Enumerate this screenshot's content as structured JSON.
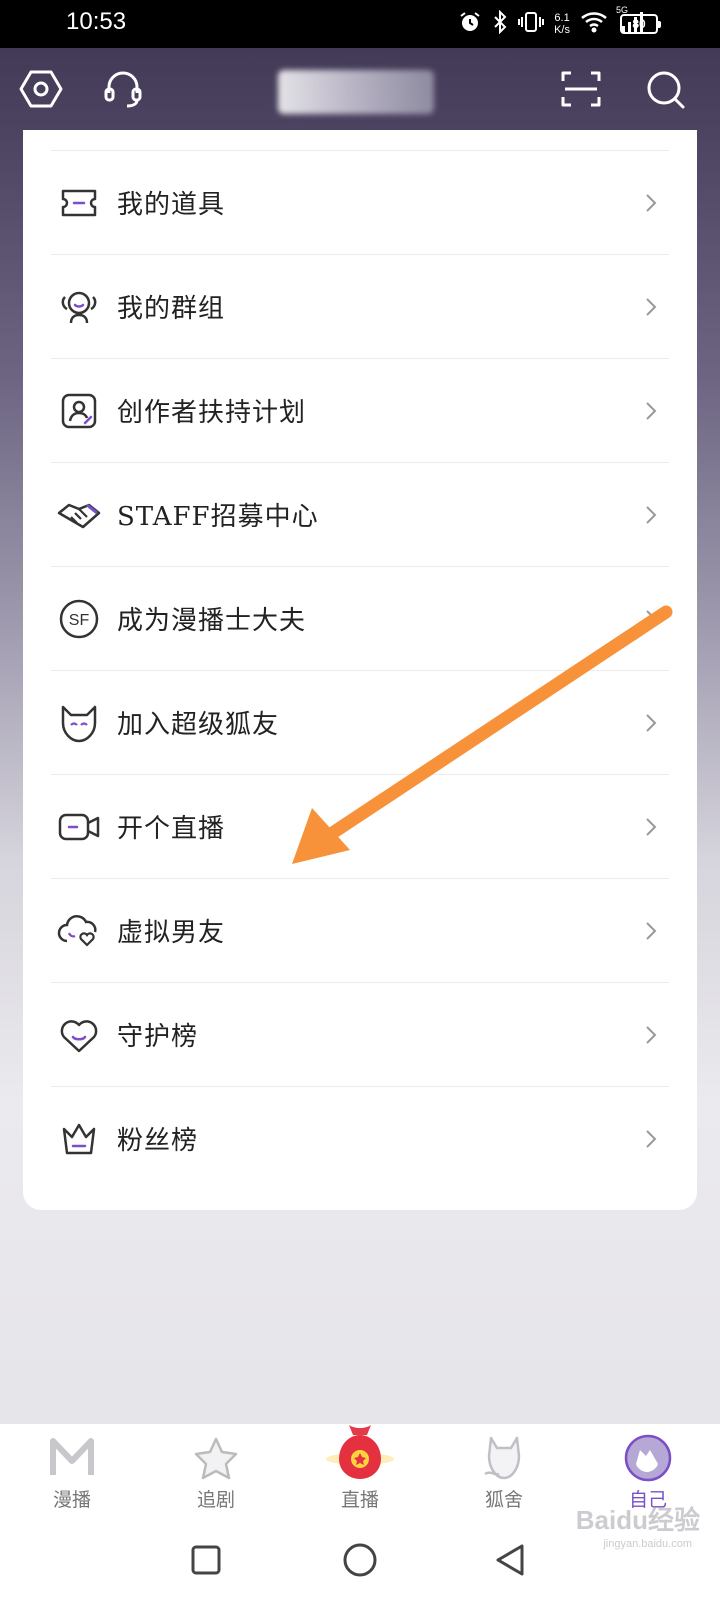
{
  "status_bar": {
    "time": "10:53",
    "net_speed_value": "6.1",
    "net_speed_unit": "K/s",
    "network": "5G",
    "battery": "80"
  },
  "header": {
    "settings_icon": "hexagon-settings-icon",
    "service_icon": "headset-icon",
    "scan_icon": "scan-icon",
    "search_icon": "search-icon"
  },
  "menu": {
    "items": [
      {
        "label": "我的道具",
        "icon": "ticket-icon"
      },
      {
        "label": "我的群组",
        "icon": "group-icon"
      },
      {
        "label": "创作者扶持计划",
        "icon": "creator-icon"
      },
      {
        "label": "STAFF招募中心",
        "icon": "handshake-icon"
      },
      {
        "label": "成为漫播士大夫",
        "icon": "sf-badge-icon"
      },
      {
        "label": "加入超级狐友",
        "icon": "fox-icon"
      },
      {
        "label": "开个直播",
        "icon": "camera-icon"
      },
      {
        "label": "虚拟男友",
        "icon": "heart-cloud-icon"
      },
      {
        "label": "守护榜",
        "icon": "heart-icon"
      },
      {
        "label": "粉丝榜",
        "icon": "crown-icon"
      }
    ]
  },
  "tabs": [
    {
      "label": "漫播",
      "icon": "m-logo-icon"
    },
    {
      "label": "追剧",
      "icon": "star-icon"
    },
    {
      "label": "直播",
      "icon": "lucky-bag-icon"
    },
    {
      "label": "狐舍",
      "icon": "fox-house-icon"
    },
    {
      "label": "自己",
      "icon": "avatar-icon",
      "active": true
    }
  ],
  "colors": {
    "accent": "#7a4fc8",
    "annotation_arrow": "#f7923a"
  },
  "watermark": {
    "main": "Baidu经验",
    "sub": "jingyan.baidu.com"
  }
}
